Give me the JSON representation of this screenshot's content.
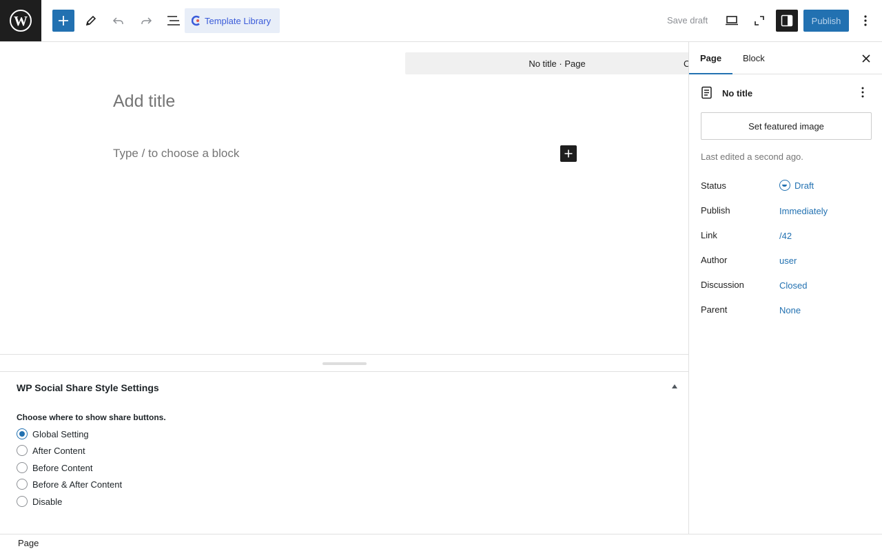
{
  "toolbar": {
    "template_library_label": "Template Library",
    "save_draft_label": "Save draft",
    "publish_label": "Publish",
    "icons": [
      "wordpress-logo-icon",
      "plus-icon",
      "pencil-icon",
      "undo-icon",
      "redo-icon",
      "list-view-icon",
      "desktop-preview-icon",
      "fullscreen-icon",
      "sidebar-toggle-icon",
      "more-options-icon"
    ],
    "accent_color": "#2271b1"
  },
  "document_bar": {
    "title": "No title · Page",
    "command_hint": "C"
  },
  "editor": {
    "title_placeholder": "Add title",
    "block_placeholder": "Type / to choose a block"
  },
  "metabox": {
    "title": "WP Social Share Style Settings",
    "prompt": "Choose where to show share buttons.",
    "options": [
      {
        "label": "Global Setting",
        "checked": true
      },
      {
        "label": "After Content",
        "checked": false
      },
      {
        "label": "Before Content",
        "checked": false
      },
      {
        "label": "Before & After Content",
        "checked": false
      },
      {
        "label": "Disable",
        "checked": false
      }
    ]
  },
  "footer": {
    "breadcrumb": "Page"
  },
  "sidebar": {
    "tabs": [
      {
        "label": "Page",
        "active": true
      },
      {
        "label": "Block",
        "active": false
      }
    ],
    "doc_title": "No title",
    "featured_image_label": "Set featured image",
    "last_edited": "Last edited a second ago.",
    "properties": [
      {
        "label": "Status",
        "value": "Draft"
      },
      {
        "label": "Publish",
        "value": "Immediately"
      },
      {
        "label": "Link",
        "value": "/42"
      },
      {
        "label": "Author",
        "value": "user"
      },
      {
        "label": "Discussion",
        "value": "Closed"
      },
      {
        "label": "Parent",
        "value": "None"
      }
    ]
  }
}
